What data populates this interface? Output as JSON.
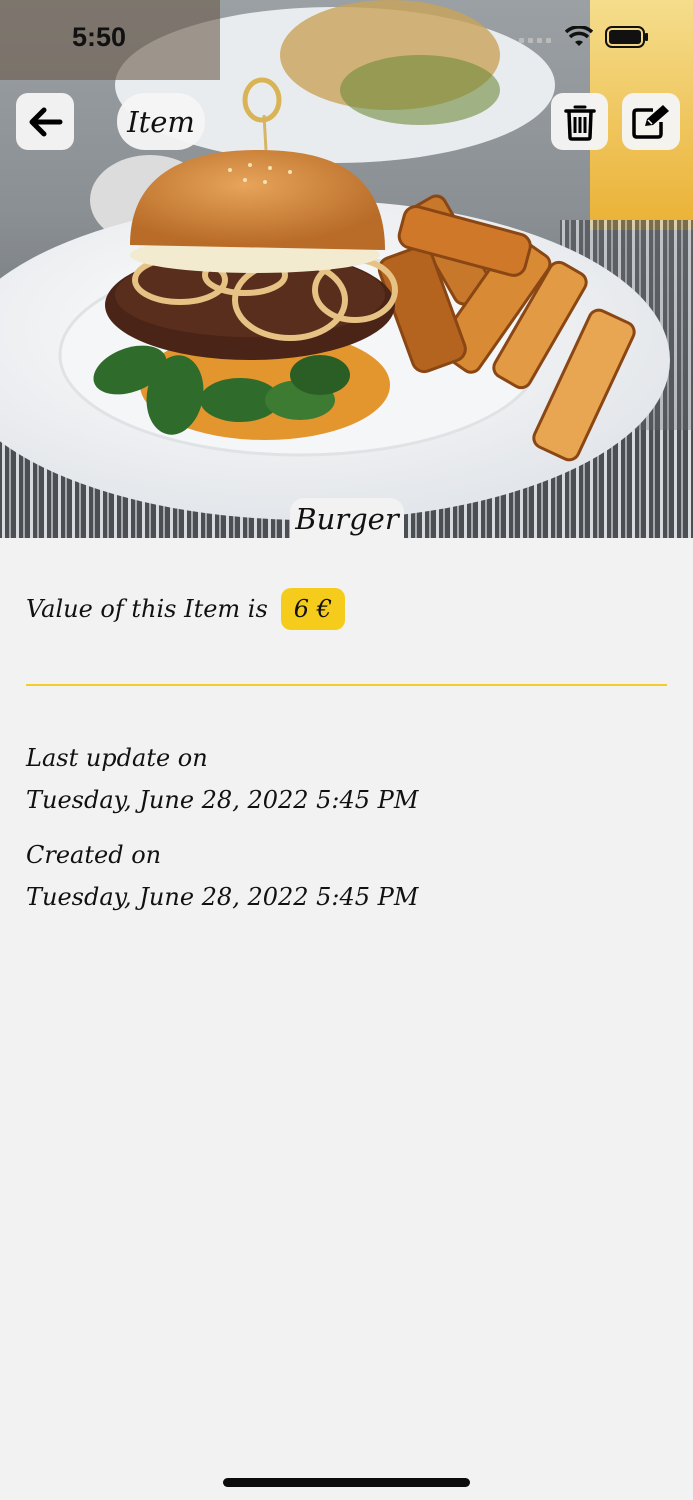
{
  "status_bar": {
    "time": "5:50"
  },
  "header": {
    "back_icon": "arrow-left-icon",
    "title": "Item",
    "delete_icon": "trash-icon",
    "edit_icon": "edit-icon"
  },
  "item": {
    "name": "Burger",
    "value_label": "Value of this Item is",
    "price": "6 €"
  },
  "meta": {
    "updated_label": "Last update on",
    "updated_value": "Tuesday, June 28, 2022 5:45 PM",
    "created_label": "Created on",
    "created_value": "Tuesday, June 28, 2022 5:45 PM"
  },
  "colors": {
    "accent": "#f6cc1c",
    "background": "#f2f2f2"
  }
}
